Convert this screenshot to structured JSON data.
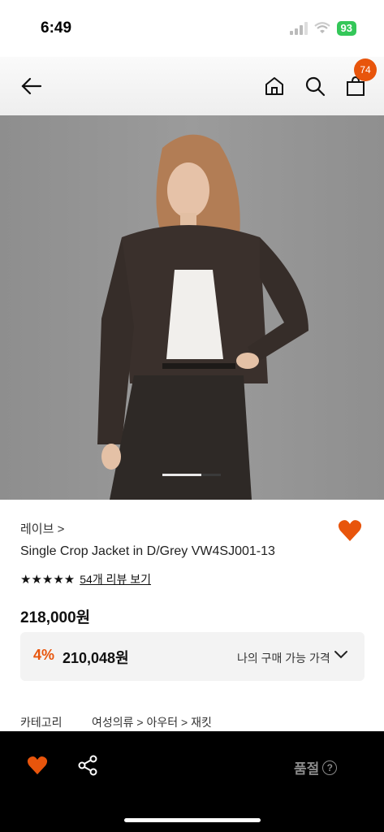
{
  "status_bar": {
    "time": "6:49",
    "battery": "93"
  },
  "nav": {
    "back_icon": "back-arrow-icon",
    "home_icon": "home-icon",
    "search_icon": "search-icon",
    "cart_icon": "shopping-bag-icon",
    "cart_count": "74"
  },
  "product": {
    "brand": "레이브 >",
    "name": "Single Crop Jacket in D/Grey VW4SJ001-13",
    "stars": "★★★★★",
    "review_link": "54개 리뷰 보기",
    "price": "218,000원",
    "discount": {
      "rate": "4%",
      "price": "210,048원",
      "label": "나의 구매 가능 가격"
    },
    "category": {
      "label": "카테고리",
      "path": "여성의류 > 아우터 > 재킷"
    }
  },
  "bottom_bar": {
    "soldout_label": "품절",
    "help_mark": "?"
  },
  "colors": {
    "accent": "#e8550c",
    "dark_bar": "#000000"
  }
}
